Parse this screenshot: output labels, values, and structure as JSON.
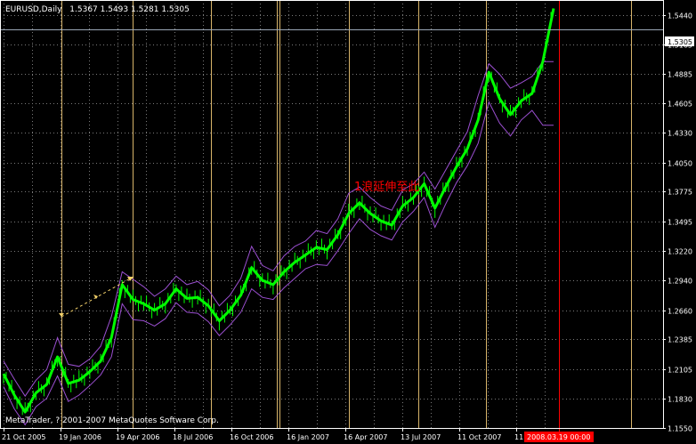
{
  "header": {
    "symbol": "EURUSD,Daily",
    "ohlc": "1.5367 1.5493 1.5281 1.5305"
  },
  "copyright": "MetaTrader, ? 2001-2007 MetaQuotes Software Corp.",
  "annotation": {
    "text": "1浪延伸至此",
    "color": "#ff0000"
  },
  "current_price_label": "1.5305",
  "cursor_time_label": "2008.03.19 00:00",
  "colors": {
    "background": "#000000",
    "candles": "#00ff00",
    "bands": "#9b4fd1",
    "vertical_lines": "#d8b46a",
    "grid": "#7a7a7a",
    "axis_text": "#ffffff",
    "cursor_line": "#ff0000",
    "arrow": "#f5d36b"
  },
  "chart_data": {
    "type": "line",
    "title": "",
    "x_tick_labels": [
      "21 Oct 2005",
      "19 Jan 2006",
      "19 Apr 2006",
      "18 Jul 2006",
      "16 Oct 2006",
      "16 Jan 2007",
      "16 Apr 2007",
      "13 Jul 2007",
      "11 Oct 2007",
      "11"
    ],
    "y_tick_labels": [
      "1.5440",
      "1.5165",
      "1.4885",
      "1.4605",
      "1.4330",
      "1.4050",
      "1.3775",
      "1.3495",
      "1.3220",
      "1.2940",
      "1.2660",
      "1.2385",
      "1.2105",
      "1.1830",
      "1.1550"
    ],
    "ylim": [
      1.155,
      1.558
    ],
    "grid": true,
    "current_price": 1.5305,
    "series": [
      {
        "values": [
          1.206,
          1.186,
          1.17,
          1.188,
          1.196,
          1.222,
          1.197,
          1.2,
          1.208,
          1.218,
          1.24,
          1.29,
          1.276,
          1.272,
          1.266,
          1.272,
          1.286,
          1.277,
          1.278,
          1.27,
          1.256,
          1.266,
          1.28,
          1.306,
          1.294,
          1.29,
          1.302,
          1.311,
          1.318,
          1.325,
          1.323,
          1.337,
          1.357,
          1.367,
          1.357,
          1.35,
          1.346,
          1.364,
          1.372,
          1.385,
          1.362,
          1.382,
          1.401,
          1.418,
          1.445,
          1.49,
          1.465,
          1.45,
          1.463,
          1.47,
          1.5,
          1.55
        ]
      },
      {
        "values": [
          1.218,
          1.201,
          1.185,
          1.2,
          1.21,
          1.24,
          1.215,
          1.213,
          1.22,
          1.232,
          1.26,
          1.302,
          1.295,
          1.288,
          1.279,
          1.286,
          1.298,
          1.29,
          1.293,
          1.285,
          1.27,
          1.28,
          1.296,
          1.326,
          1.308,
          1.303,
          1.317,
          1.326,
          1.331,
          1.341,
          1.338,
          1.352,
          1.376,
          1.382,
          1.372,
          1.364,
          1.36,
          1.379,
          1.385,
          1.396,
          1.38,
          1.398,
          1.416,
          1.434,
          1.468,
          1.498,
          1.488,
          1.475,
          1.48,
          1.486,
          1.5,
          1.5
        ]
      },
      {
        "values": [
          1.194,
          1.173,
          1.158,
          1.175,
          1.183,
          1.204,
          1.18,
          1.186,
          1.195,
          1.205,
          1.222,
          1.272,
          1.257,
          1.256,
          1.251,
          1.258,
          1.273,
          1.264,
          1.263,
          1.255,
          1.242,
          1.252,
          1.264,
          1.286,
          1.278,
          1.276,
          1.287,
          1.296,
          1.305,
          1.309,
          1.308,
          1.322,
          1.338,
          1.352,
          1.342,
          1.336,
          1.332,
          1.349,
          1.359,
          1.372,
          1.344,
          1.366,
          1.386,
          1.402,
          1.423,
          1.462,
          1.442,
          1.43,
          1.445,
          1.454,
          1.44,
          1.44
        ]
      }
    ]
  }
}
